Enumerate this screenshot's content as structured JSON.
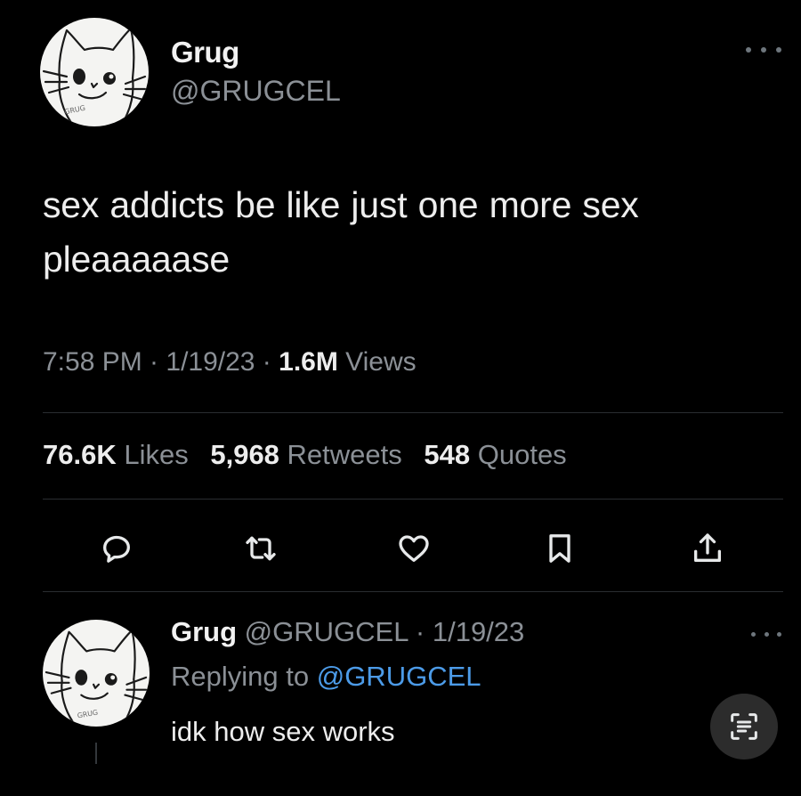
{
  "tweet": {
    "author": {
      "name": "Grug",
      "handle": "@GRUGCEL",
      "avatar_caption": "GRUG"
    },
    "text_line1": "sex addicts be like just one more sex",
    "text_line2": "pleaaaaase",
    "timestamp": "7:58 PM · 1/19/23 · ",
    "views_count": "1.6M",
    "views_label": " Views",
    "stats": {
      "likes_count": "76.6K",
      "likes_label": " Likes",
      "retweets_count": "5,968",
      "retweets_label": " Retweets",
      "quotes_count": "548",
      "quotes_label": " Quotes"
    },
    "actions": {
      "icons": [
        "reply-icon",
        "retweet-icon",
        "like-icon",
        "bookmark-icon",
        "share-icon"
      ]
    }
  },
  "reply": {
    "author_name": "Grug",
    "handle_date": " @GRUGCEL · 1/19/23",
    "replying_label": "Replying to ",
    "replying_mention": "@GRUGCEL",
    "text": "idk how sex works",
    "avatar_caption": "GRUG"
  },
  "colors": {
    "background": "#000000",
    "text_primary": "#ededed",
    "text_secondary": "#8b9096",
    "mention": "#4c9be8",
    "divider": "#2a2d31"
  }
}
